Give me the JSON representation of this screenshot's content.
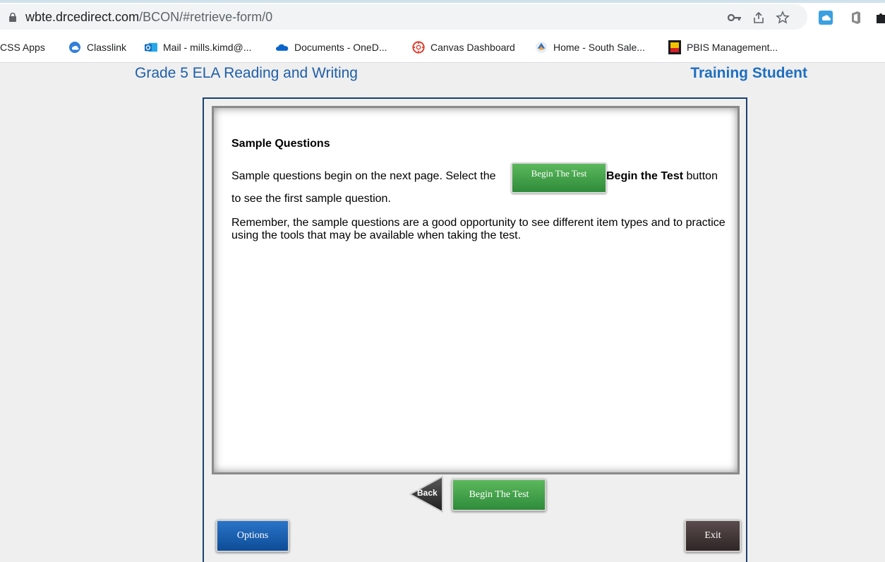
{
  "browser": {
    "url_host": "wbte.drcedirect.com",
    "url_path": "/BCON/#retrieve-form/0",
    "bookmarks": [
      {
        "label": "CSS Apps",
        "icon": "none"
      },
      {
        "label": "Classlink",
        "icon": "classlink-icon",
        "color": "#2f7fd8"
      },
      {
        "label": "Mail - mills.kimd@...",
        "icon": "outlook-icon",
        "color": "#0f6cbd"
      },
      {
        "label": "Documents - OneD...",
        "icon": "onedrive-icon",
        "color": "#0a64c9"
      },
      {
        "label": "Canvas Dashboard",
        "icon": "canvas-icon",
        "color": "#e03e2d"
      },
      {
        "label": "Home - South Sale...",
        "icon": "home-site-icon",
        "color": "#3b6fb6"
      },
      {
        "label": "PBIS Management...",
        "icon": "pbis-icon",
        "color": "#d4202a"
      }
    ]
  },
  "header": {
    "test_title": "Grade 5 ELA Reading and Writing",
    "student_name": "Training Student"
  },
  "content": {
    "heading": "Sample Questions",
    "para1_start": "Sample questions begin on the next page. Select the",
    "para1_button": "Begin The Test",
    "para1_bold": "Begin the Test",
    "para1_after": " button",
    "para1_end": "to see the first sample question.",
    "para2": "Remember, the sample questions are a good opportunity to see different item types and to practice using the tools that may be available when taking the test."
  },
  "nav": {
    "back_label": "Back",
    "begin_label": "Begin The Test",
    "options_label": "Options",
    "exit_label": "Exit"
  },
  "colors": {
    "title_blue": "#1f5fa9",
    "frame_navy": "#1c3f73",
    "begin_green": "#2e8b3a",
    "options_blue": "#0d4c97",
    "exit_dark": "#2f2626"
  }
}
